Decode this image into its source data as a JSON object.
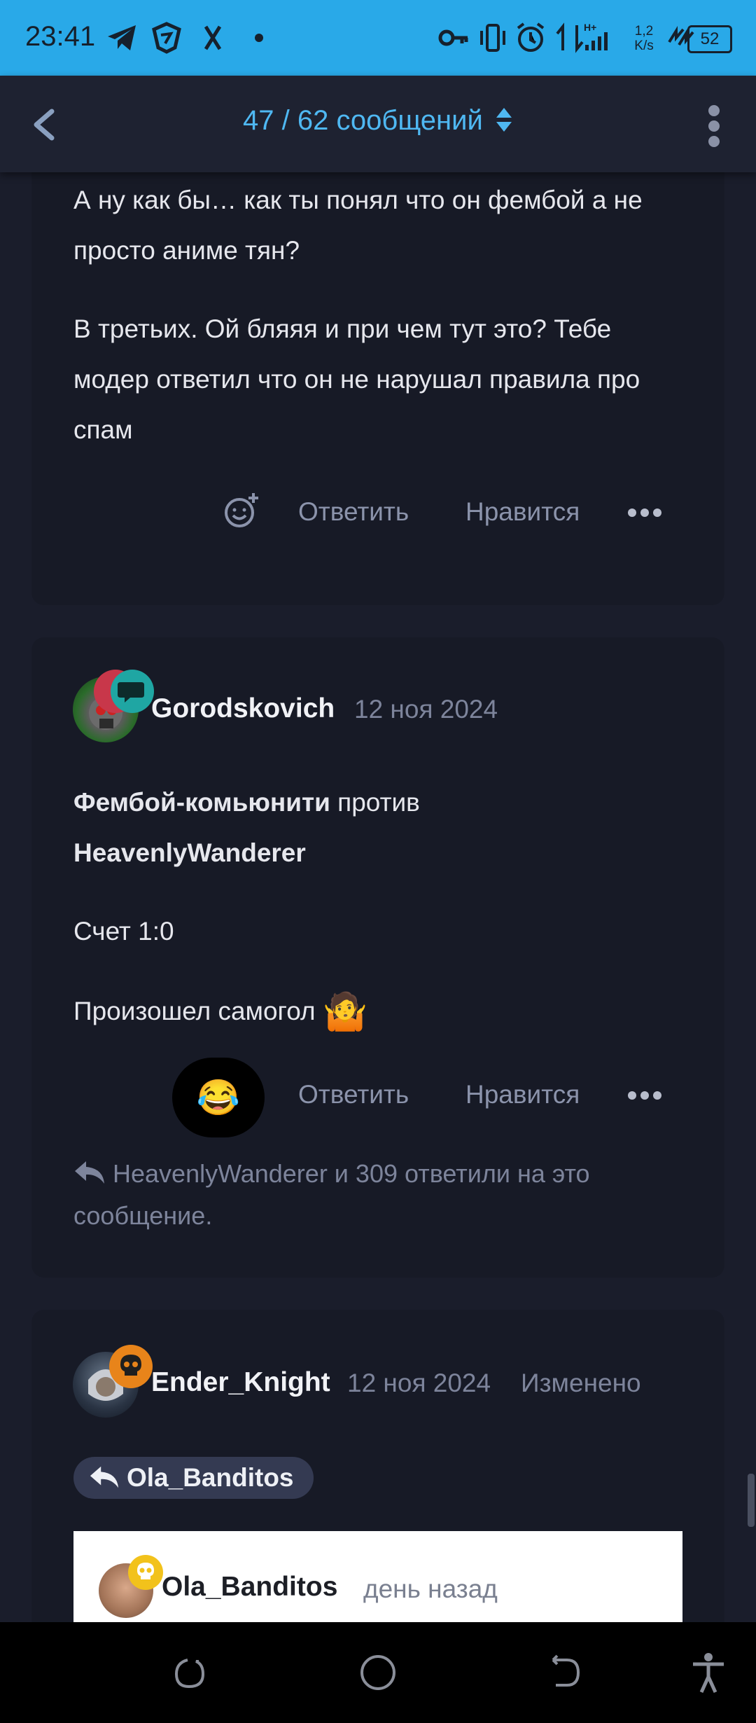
{
  "status_bar": {
    "time": "23:41",
    "net_speed": "1,2\nK/s",
    "battery": "52"
  },
  "header": {
    "title": "47 / 62 сообщений"
  },
  "post1": {
    "para1": "А ну как бы… как ты понял что он фембой а не просто аниме тян?",
    "para2": "В третьих. Ой бляяя и при чем тут это? Тебе модер ответил что он не нарушал правила про спам",
    "reply_label": "Ответить",
    "like_label": "Нравится"
  },
  "post2": {
    "username": "Gorodskovich",
    "date": "12 ноя 2024",
    "line1_bold": "Фембой-комьюнити",
    "line1_rest": " против",
    "line2_bold": "HeavenlyWanderer",
    "line3": "Счет 1:0",
    "line4": "Произошел самогол",
    "emoji_reaction": "😂",
    "trailing_emoji": "🤷",
    "reply_label": "Ответить",
    "like_label": "Нравится",
    "replies_text": "HeavenlyWanderer и 309 ответили на это сообщение."
  },
  "post3": {
    "username": "Ender_Knight",
    "date": "12 ноя 2024",
    "edited": "Изменено",
    "reply_to": "Ola_Banditos",
    "quote_user": "Ola_Banditos",
    "quote_time": "день назад"
  },
  "colors": {
    "accent": "#4fb8f2",
    "status_bar": "#29a9e8",
    "card": "#171a26",
    "background": "#1a1d2b",
    "badge_orange": "#e8841a",
    "badge_yellow": "#f2c21b"
  }
}
